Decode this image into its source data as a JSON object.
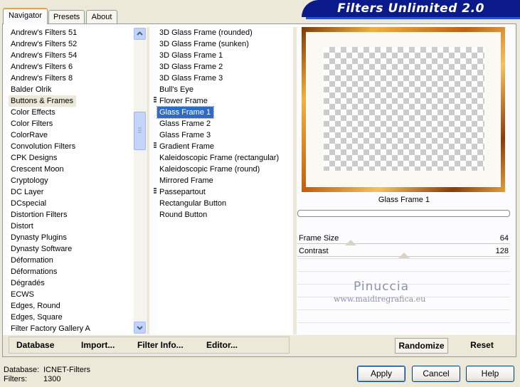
{
  "tabs": [
    "Navigator",
    "Presets",
    "About"
  ],
  "app_title": "Filters Unlimited 2.0",
  "categories": [
    "Andrew's Filters 51",
    "Andrew's Filters 52",
    "Andrew's Filters 54",
    "Andrew's Filters 6",
    "Andrew's Filters 8",
    "Balder Olrik",
    "Buttons & Frames",
    "Color Effects",
    "Color Filters",
    "ColorRave",
    "Convolution Filters",
    "CPK Designs",
    "Crescent Moon",
    "Cryptology",
    "DC Layer",
    "DCspecial",
    "Distortion Filters",
    "Distort",
    "Dynasty Plugins",
    "Dynasty Software",
    "Déformation",
    "Déformations",
    "Dégradés",
    "ECWS",
    "Edges, Round",
    "Edges, Square",
    "Filter Factory Gallery A"
  ],
  "selected_category": "Buttons & Frames",
  "filters": [
    "3D Glass Frame (rounded)",
    "3D Glass Frame (sunken)",
    "3D Glass Frame 1",
    "3D Glass Frame 2",
    "3D Glass Frame 3",
    "Bull's Eye",
    "Flower Frame",
    "Glass Frame 1",
    "Glass Frame 2",
    "Glass Frame 3",
    "Gradient Frame",
    "Kaleidoscopic Frame (rectangular)",
    "Kaleidoscopic Frame (round)",
    "Mirrored Frame",
    "Passepartout",
    "Rectangular Button",
    "Round Button"
  ],
  "selected_filter": "Glass Frame 1",
  "preview": {
    "filter_name": "Glass Frame 1"
  },
  "params": [
    {
      "label": "Frame Size",
      "value": "64"
    },
    {
      "label": "Contrast",
      "value": "128"
    }
  ],
  "watermark": {
    "line1": "Pinuccia",
    "line2": "www.maidiregrafica.eu"
  },
  "bottom_links": {
    "database": "Database",
    "import": "Import...",
    "filter_info": "Filter Info...",
    "editor": "Editor..."
  },
  "actions": {
    "randomize": "Randomize",
    "reset": "Reset",
    "apply": "Apply",
    "cancel": "Cancel",
    "help": "Help"
  },
  "status": {
    "database_label": "Database:",
    "database_value": "ICNET-Filters",
    "filters_label": "Filters:",
    "filters_value": "1300"
  },
  "colors": {
    "banner": "#0a1a8a",
    "selection": "#316ac5",
    "tab_accent": "#f0a030"
  }
}
